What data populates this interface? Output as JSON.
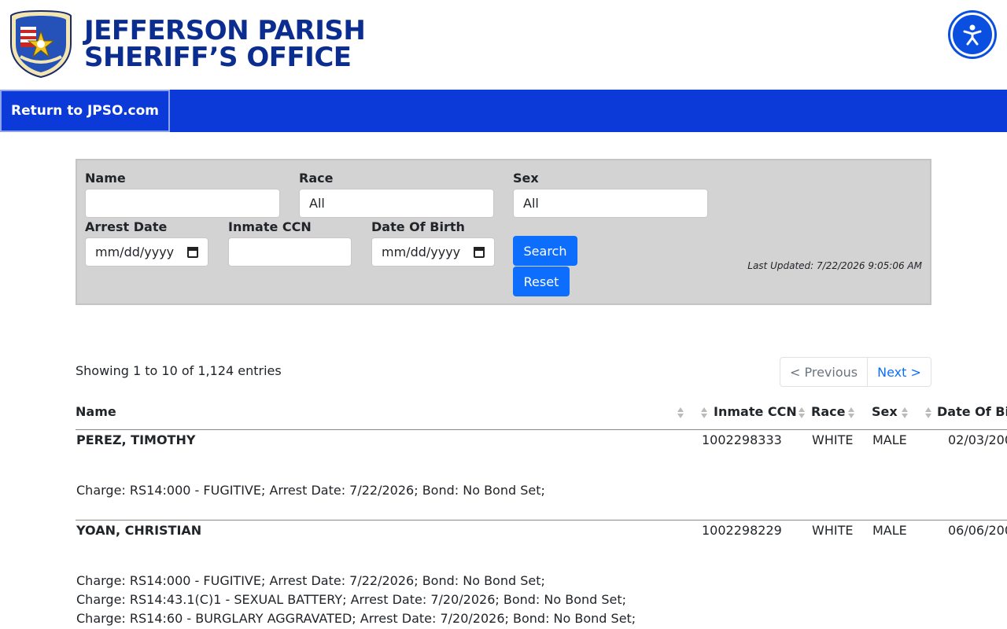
{
  "header": {
    "logo_text": "SHERIFF'S OFFICE JEFFERSON PARISH",
    "title_line1": "JEFFERSON PARISH",
    "title_line2": "SHERIFF’S OFFICE",
    "accessibility_icon": "accessibility-icon"
  },
  "nav": {
    "return_label": "Return to JPSO.com"
  },
  "search": {
    "name_label": "Name",
    "name_value": "",
    "race_label": "Race",
    "race_value": "All",
    "sex_label": "Sex",
    "sex_value": "All",
    "arrest_date_label": "Arrest Date",
    "arrest_date_value": "mm/dd/yyyy",
    "ccn_label": "Inmate CCN",
    "ccn_value": "",
    "dob_label": "Date Of Birth",
    "dob_value": "mm/dd/yyyy",
    "search_button": "Search",
    "reset_button": "Reset",
    "last_updated": "Last Updated: 7/22/2026 9:05:06 AM"
  },
  "pagination": {
    "showing": "Showing 1 to 10 of 1,124 entries",
    "previous": "< Previous",
    "next": "Next >"
  },
  "table": {
    "columns": [
      "Name",
      "Inmate CCN",
      "Race",
      "Sex",
      "Date Of Bi"
    ],
    "rows": [
      {
        "name": "PEREZ, TIMOTHY",
        "ccn": "1002298333",
        "race": "WHITE",
        "sex": "MALE",
        "dob": "02/03/200",
        "charges": [
          "Charge: RS14:000 - FUGITIVE; Arrest Date: 7/22/2026; Bond: No Bond Set;"
        ]
      },
      {
        "name": "YOAN, CHRISTIAN",
        "ccn": "1002298229",
        "race": "WHITE",
        "sex": "MALE",
        "dob": "06/06/200",
        "charges": [
          "Charge: RS14:000 - FUGITIVE; Arrest Date: 7/22/2026; Bond: No Bond Set;",
          "Charge: RS14:43.1(C)1 - SEXUAL BATTERY; Arrest Date: 7/20/2026; Bond: No Bond Set;",
          "Charge: RS14:60 - BURGLARY AGGRAVATED; Arrest Date: 7/20/2026; Bond: No Bond Set;"
        ]
      }
    ]
  }
}
